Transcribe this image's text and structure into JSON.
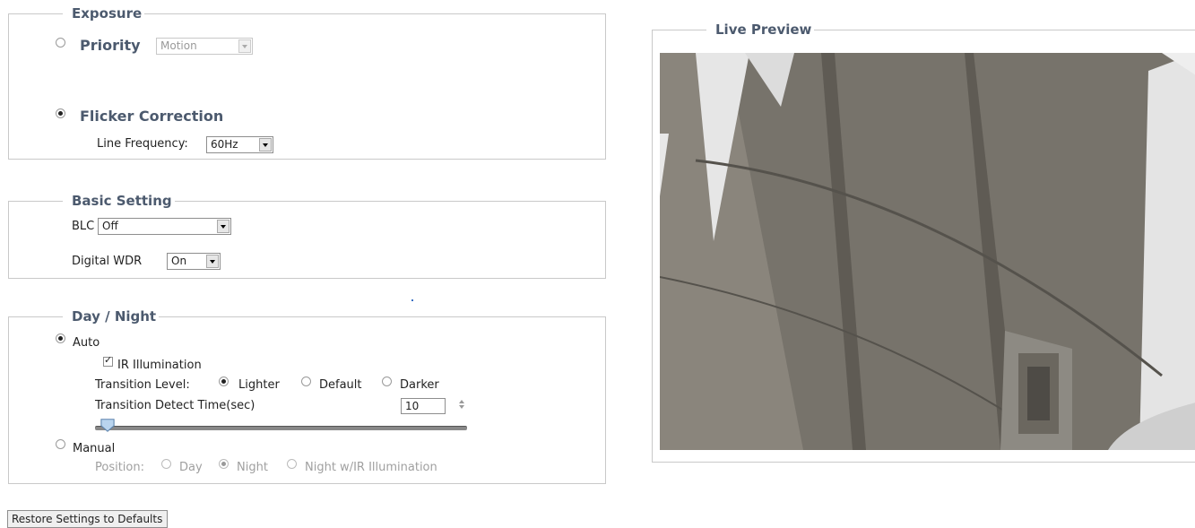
{
  "exposure": {
    "title": "Exposure",
    "priority_label": "Priority",
    "priority_value": "Motion",
    "flicker_label": "Flicker Correction",
    "line_freq_label": "Line Frequency:",
    "line_freq_value": "60Hz"
  },
  "basic": {
    "title": "Basic Setting",
    "blc_label": "BLC",
    "blc_value": "Off",
    "wdr_label": "Digital WDR",
    "wdr_value": "On"
  },
  "daynight": {
    "title": "Day / Night",
    "auto_label": "Auto",
    "ir_label": "IR Illumination",
    "transition_level_label": "Transition Level:",
    "lighter_label": "Lighter",
    "default_label": "Default",
    "darker_label": "Darker",
    "detect_time_label": "Transition Detect Time(sec)",
    "detect_time_value": "10",
    "slider_fraction": 0.03,
    "manual_label": "Manual",
    "position_label": "Position:",
    "day_label": "Day",
    "night_label": "Night",
    "night_ir_label": "Night w/IR Illumination"
  },
  "preview": {
    "title": "Live Preview"
  },
  "restore_button": "Restore Settings to Defaults",
  "colors": {
    "heading": "#4c5a6e",
    "border": "#c9c9c9"
  }
}
